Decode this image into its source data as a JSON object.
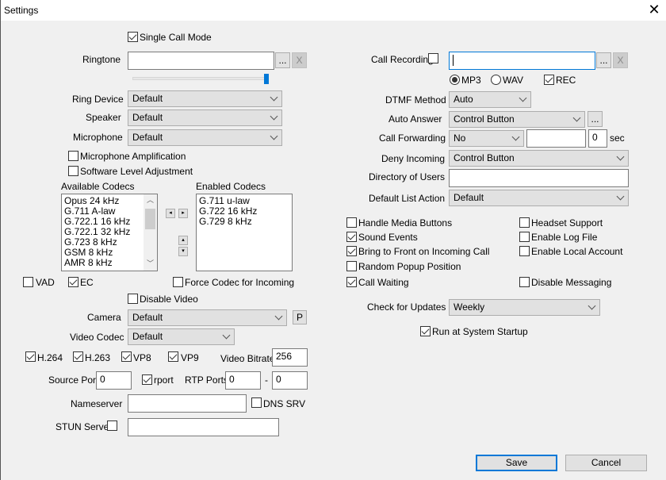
{
  "window": {
    "title": "Settings",
    "close_label": "✕"
  },
  "left": {
    "single_call_mode": {
      "label": "Single Call Mode",
      "checked": true
    },
    "ringtone": {
      "label": "Ringtone",
      "value": "",
      "browse": "...",
      "clear": "X",
      "volume": 1.0
    },
    "ring_device": {
      "label": "Ring Device",
      "value": "Default"
    },
    "speaker": {
      "label": "Speaker",
      "value": "Default"
    },
    "microphone": {
      "label": "Microphone",
      "value": "Default"
    },
    "mic_amplification": {
      "label": "Microphone Amplification",
      "checked": false
    },
    "software_level": {
      "label": "Software Level Adjustment",
      "checked": false
    },
    "available_codecs": {
      "label": "Available Codecs",
      "items": [
        "Opus 24 kHz",
        "G.711 A-law",
        "G.722.1 16 kHz",
        "G.722.1 32 kHz",
        "G.723 8 kHz",
        "GSM 8 kHz",
        "AMR 8 kHz"
      ]
    },
    "enabled_codecs": {
      "label": "Enabled Codecs",
      "items": [
        "G.711 u-law",
        "G.722 16 kHz",
        "G.729 8 kHz"
      ]
    },
    "move_left": "◂",
    "move_right": "▸",
    "move_up": "▴",
    "move_down": "▾",
    "vad": {
      "label": "VAD",
      "checked": false
    },
    "ec": {
      "label": "EC",
      "checked": true
    },
    "force_codec": {
      "label": "Force Codec for Incoming",
      "checked": false
    },
    "disable_video": {
      "label": "Disable Video",
      "checked": false
    },
    "camera": {
      "label": "Camera",
      "value": "Default",
      "button": "P"
    },
    "video_codec": {
      "label": "Video Codec",
      "value": "Default"
    },
    "h264": {
      "label": "H.264",
      "checked": true
    },
    "h263": {
      "label": "H.263",
      "checked": true
    },
    "vp8": {
      "label": "VP8",
      "checked": true
    },
    "vp9": {
      "label": "VP9",
      "checked": true
    },
    "video_bitrate": {
      "label": "Video Bitrate",
      "value": "256"
    },
    "source_port": {
      "label": "Source Port",
      "value": "0"
    },
    "rport": {
      "label": "rport",
      "checked": true
    },
    "rtp_ports": {
      "label": "RTP Ports",
      "from": "0",
      "separator": "-",
      "to": "0"
    },
    "nameserver": {
      "label": "Nameserver",
      "value": ""
    },
    "dns_srv": {
      "label": "DNS SRV",
      "checked": false
    },
    "stun_server": {
      "label": "STUN Server",
      "checked": false,
      "value": ""
    }
  },
  "right": {
    "call_recording": {
      "label": "Call Recording",
      "checked": false,
      "value": "",
      "browse": "...",
      "clear": "X"
    },
    "mp3": {
      "label": "MP3",
      "selected": true
    },
    "wav": {
      "label": "WAV",
      "selected": false
    },
    "rec": {
      "label": "REC",
      "checked": true
    },
    "dtmf_method": {
      "label": "DTMF Method",
      "value": "Auto"
    },
    "auto_answer": {
      "label": "Auto Answer",
      "value": "Control Button",
      "button": "..."
    },
    "call_forwarding": {
      "label": "Call Forwarding",
      "value": "No",
      "number": "",
      "delay": "0",
      "unit": "sec"
    },
    "deny_incoming": {
      "label": "Deny Incoming",
      "value": "Control Button"
    },
    "directory_of_users": {
      "label": "Directory of Users",
      "value": ""
    },
    "default_list_action": {
      "label": "Default List Action",
      "value": "Default"
    },
    "checkboxes": [
      {
        "label": "Handle Media Buttons",
        "checked": false
      },
      {
        "label": "Sound Events",
        "checked": true
      },
      {
        "label": "Bring to Front on Incoming Call",
        "checked": true
      },
      {
        "label": "Random Popup Position",
        "checked": false
      },
      {
        "label": "Call Waiting",
        "checked": true
      },
      {
        "label": "Headset Support",
        "checked": false
      },
      {
        "label": "Enable Log File",
        "checked": false
      },
      {
        "label": "Enable Local Account",
        "checked": false
      },
      {
        "label": "Disable Messaging",
        "checked": false
      }
    ],
    "check_for_updates": {
      "label": "Check for Updates",
      "value": "Weekly"
    },
    "run_at_startup": {
      "label": "Run at System Startup",
      "checked": true
    }
  },
  "footer": {
    "save": "Save",
    "cancel": "Cancel"
  },
  "colors": {
    "accent": "#0078d7",
    "background": "#f0f0f0"
  }
}
